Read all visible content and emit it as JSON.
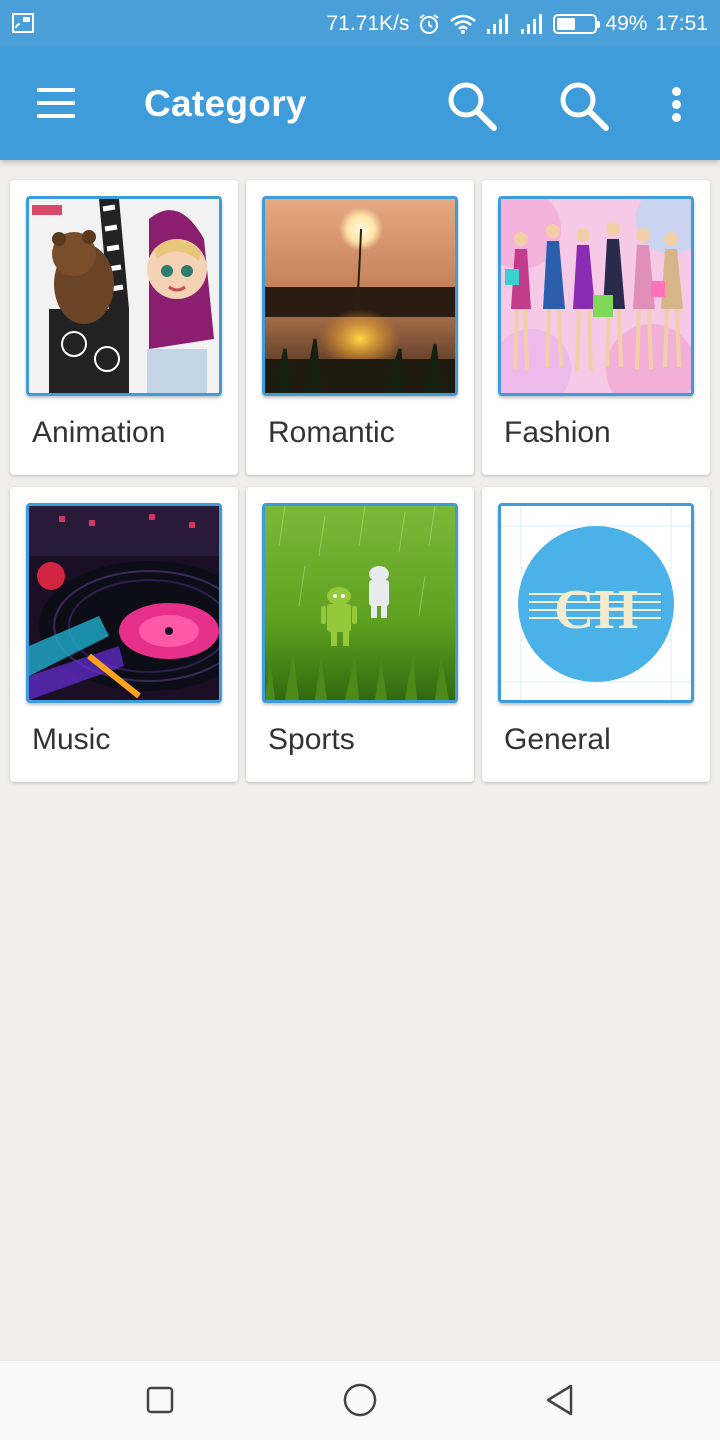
{
  "status_bar": {
    "network_speed": "71.71K/s",
    "battery_percent": "49%",
    "battery_level": 0.49,
    "time": "17:51",
    "icons": [
      "cast-icon",
      "alarm-icon",
      "wifi-icon",
      "signal-icon",
      "signal-icon-2",
      "battery-icon"
    ]
  },
  "app_bar": {
    "title": "Category",
    "color": "#3d9cd9",
    "icons": [
      "menu-icon",
      "search-icon",
      "search-icon",
      "more-vert-icon"
    ]
  },
  "categories": [
    {
      "label": "Animation"
    },
    {
      "label": "Romantic"
    },
    {
      "label": "Fashion"
    },
    {
      "label": "Music"
    },
    {
      "label": "Sports"
    },
    {
      "label": "General",
      "thumb_text": "CH"
    }
  ],
  "nav_bar": {
    "icons": [
      "recent-apps-icon",
      "home-icon",
      "back-icon"
    ]
  }
}
